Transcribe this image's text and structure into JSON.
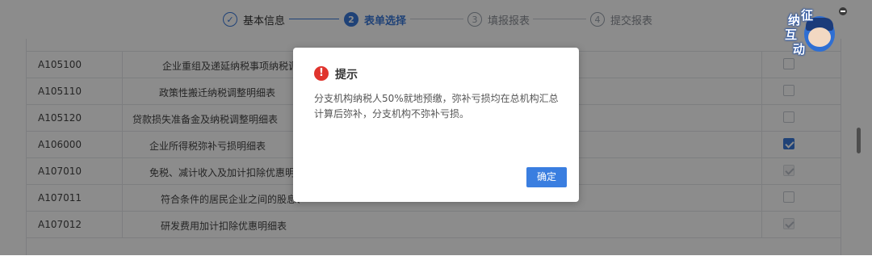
{
  "steps": [
    {
      "num": "✓",
      "label": "基本信息"
    },
    {
      "num": "2",
      "label": "表单选择"
    },
    {
      "num": "3",
      "label": "填报报表"
    },
    {
      "num": "4",
      "label": "提交报表"
    }
  ],
  "table": {
    "rows": [
      {
        "code": "A105100",
        "name": "企业重组及递延纳税事项纳税调整",
        "check": "off"
      },
      {
        "code": "A105110",
        "name": "政策性搬迁纳税调整明细表",
        "check": "off"
      },
      {
        "code": "A105120",
        "name": "贷款损失准备金及纳税调整明细表",
        "check": "off"
      },
      {
        "code": "A106000",
        "name": "企业所得税弥补亏损明细表",
        "check": "on"
      },
      {
        "code": "A107010",
        "name": "免税、减计收入及加计扣除优惠明细",
        "check": "disabled"
      },
      {
        "code": "A107011",
        "name": "符合条件的居民企业之间的股息、",
        "check": "off"
      },
      {
        "code": "A107012",
        "name": "研发费用加计扣除优惠明细表",
        "check": "disabled"
      }
    ]
  },
  "mascot": {
    "chars": [
      "征",
      "纳",
      "互",
      "动"
    ]
  },
  "dialog": {
    "title": "提示",
    "message": "分支机构纳税人50%就地预缴，弥补亏损均在总机构汇总计算后弥补，分支机构不弥补亏损。",
    "confirm_label": "确定"
  },
  "colors": {
    "accent": "#3a78d9",
    "danger": "#e0342d",
    "overlay": "rgba(0,0,0,0.45)"
  }
}
